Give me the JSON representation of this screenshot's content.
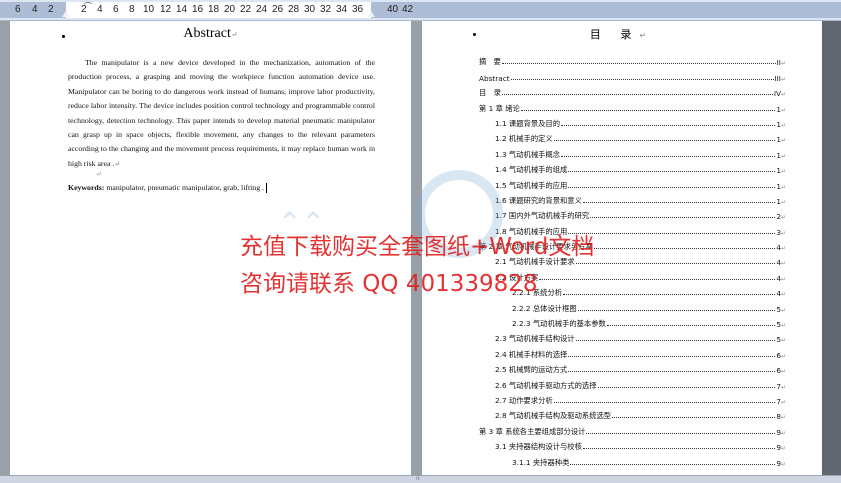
{
  "ruler": {
    "numbers": [
      "6",
      "4",
      "2",
      "2",
      "4",
      "6",
      "8",
      "10",
      "12",
      "14",
      "16",
      "18",
      "20",
      "22",
      "24",
      "26",
      "28",
      "30",
      "32",
      "34",
      "36",
      "40",
      "42"
    ]
  },
  "abstract": {
    "title": "Abstract",
    "body": "The manipulator is a new device developed in the mechanization, automation of the production process, a grasping and moving the workpiece function automation device use. Manipulator can be boring to do dangerous work instead of humans, improve labor productivity, reduce labor intensity. The device includes position control technology and programmable control technology, detection technology. This paper intends to develop material pneumatic manipulator can grasp up in space objects, flexible movement, any changes to the relevant parameters according to the changing and the movement process requirements, it may replace human work in high risk area .",
    "keywords_label": "Keywords:",
    "keywords": " manipulator, pneumatic manipulator, grab, lifting ."
  },
  "toc": {
    "title": "目 录",
    "entries": [
      {
        "label": "摘　要",
        "page": "II",
        "level": 1
      },
      {
        "label": "Abstract",
        "page": "III",
        "level": 1
      },
      {
        "label": "目　录",
        "page": "IV",
        "level": 1
      },
      {
        "label": "第 1 章  绪论",
        "page": "1",
        "level": 1
      },
      {
        "label": "1.1  课题背景及目的",
        "page": "1",
        "level": 2
      },
      {
        "label": "1.2  机械手的定义",
        "page": "1",
        "level": 2
      },
      {
        "label": "1.3  气动机械手概念",
        "page": "1",
        "level": 2
      },
      {
        "label": "1.4  气动机械手的组成",
        "page": "1",
        "level": 2
      },
      {
        "label": "1.5  气动机械手的应用",
        "page": "1",
        "level": 2
      },
      {
        "label": "1.6  课题研究的背景和意义",
        "page": "1",
        "level": 2
      },
      {
        "label": "1.7  国内外气动机械手的研究",
        "page": "2",
        "level": 2
      },
      {
        "label": "1.8  气动机械手的应用",
        "page": "3",
        "level": 2
      },
      {
        "label": "第 2 章  气动机械手设计要求与方案",
        "page": "4",
        "level": 1
      },
      {
        "label": "2.1  气动机械手设计要求",
        "page": "4",
        "level": 2
      },
      {
        "label": "2.2  设计方案",
        "page": "4",
        "level": 2
      },
      {
        "label": "2.2.1  系统分析",
        "page": "4",
        "level": 3
      },
      {
        "label": "2.2.2  总体设计框图",
        "page": "5",
        "level": 3
      },
      {
        "label": "2.2.3  气动机械手的基本参数",
        "page": "5",
        "level": 3
      },
      {
        "label": "2.3  气动机械手结构设计",
        "page": "5",
        "level": 2
      },
      {
        "label": "2.4  机械手材料的选择",
        "page": "6",
        "level": 2
      },
      {
        "label": "2.5  机械臂的运动方式",
        "page": "6",
        "level": 2
      },
      {
        "label": "2.6  气动机械手驱动方式的选择",
        "page": "7",
        "level": 2
      },
      {
        "label": "2.7  动作要求分析",
        "page": "7",
        "level": 2
      },
      {
        "label": "2.8  气动机械手结构及驱动系统选型",
        "page": "8",
        "level": 2
      },
      {
        "label": "第 3 章  系统各主要组成部分设计",
        "page": "9",
        "level": 1
      },
      {
        "label": "3.1  夹持器结构设计与校核",
        "page": "9",
        "level": 2
      },
      {
        "label": "3.1.1  夹持器种类",
        "page": "9",
        "level": 3
      }
    ]
  },
  "watermark": {
    "line1": "充值下载购买全套图纸+Word文档",
    "line2": "咨询请联系  QQ 401339828"
  },
  "colors": {
    "watermark": "#e21d1d",
    "ruler_bg": "#dbe5f3",
    "gray_bg": "#9aa0a8"
  }
}
